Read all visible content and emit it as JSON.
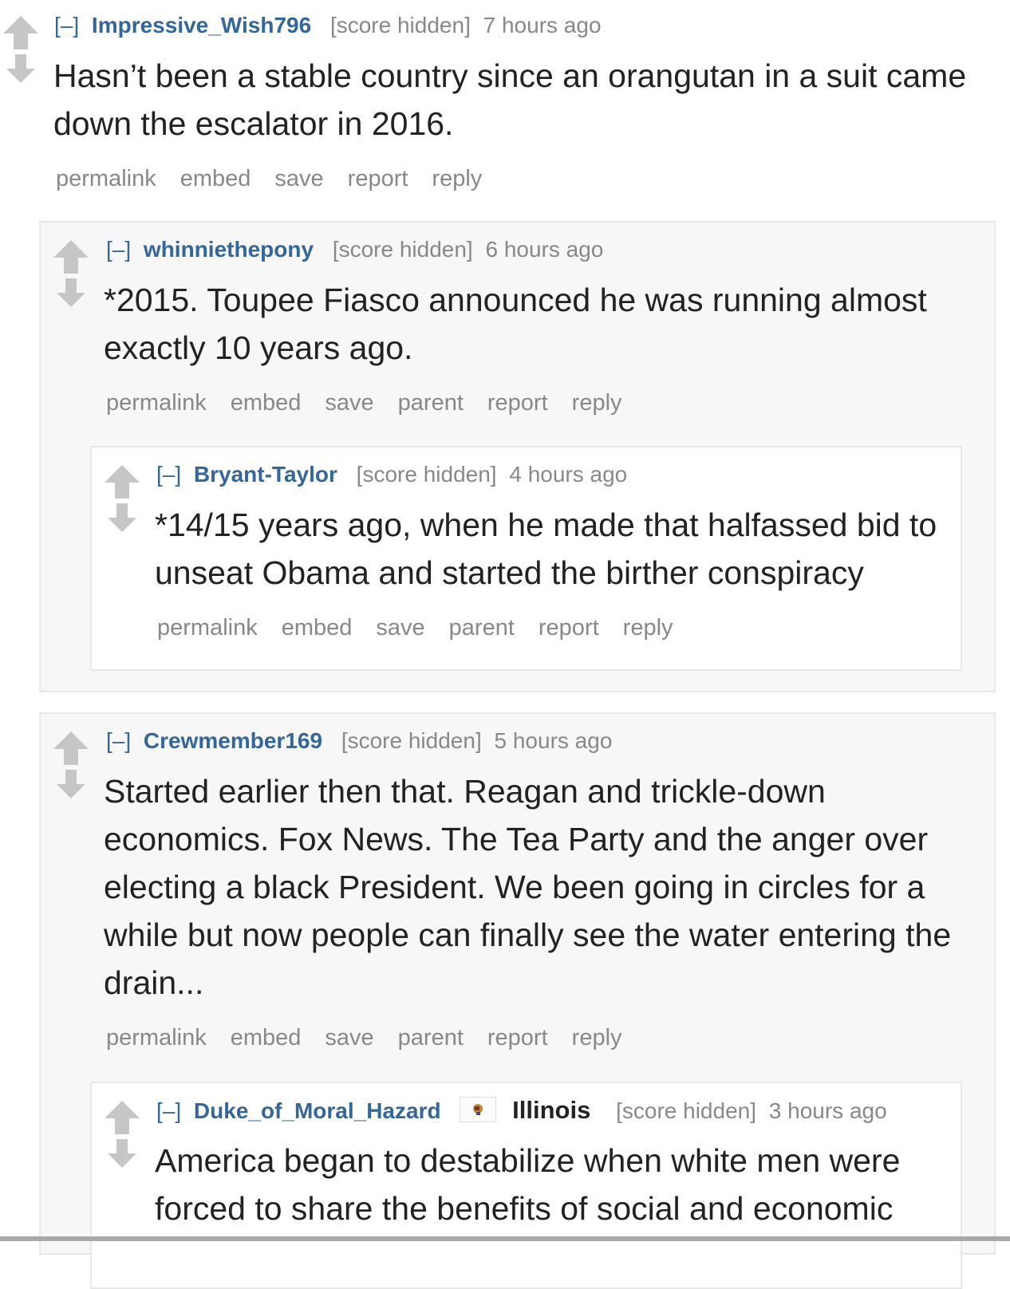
{
  "colors": {
    "author": "#336699",
    "meta": "#888888",
    "body_text": "#222222",
    "nested_bg_gray": "#f7f7f8",
    "border": "#e8e8e8",
    "arrow": "#c6c6c6"
  },
  "icons": {
    "upvote": "upvote-arrow-icon",
    "downvote": "downvote-arrow-icon",
    "flair": "illinois-flag-icon"
  },
  "comments": {
    "c1": {
      "toggle": "[–]",
      "author": "Impressive_Wish796",
      "score": "[score hidden]",
      "time": "7 hours ago",
      "body": "Hasn’t been a stable country since an orangutan in a suit came down the escalator in 2016.",
      "buttons": [
        "permalink",
        "embed",
        "save",
        "report",
        "reply"
      ]
    },
    "c2": {
      "toggle": "[–]",
      "author": "whinniethepony",
      "score": "[score hidden]",
      "time": "6 hours ago",
      "body": "*2015. Toupee Fiasco announced he was running almost exactly 10 years ago.",
      "buttons": [
        "permalink",
        "embed",
        "save",
        "parent",
        "report",
        "reply"
      ]
    },
    "c3": {
      "toggle": "[–]",
      "author": "Bryant-Taylor",
      "score": "[score hidden]",
      "time": "4 hours ago",
      "body": "*14/15 years ago, when he made that halfassed bid to unseat Obama and started the birther conspiracy",
      "buttons": [
        "permalink",
        "embed",
        "save",
        "parent",
        "report",
        "reply"
      ]
    },
    "c4": {
      "toggle": "[–]",
      "author": "Crewmember169",
      "score": "[score hidden]",
      "time": "5 hours ago",
      "body": "Started earlier then that. Reagan and trickle-down economics. Fox News. The Tea Party and the anger over electing a black President. We been going in circles for a while but now people can finally see the water entering the drain...",
      "buttons": [
        "permalink",
        "embed",
        "save",
        "parent",
        "report",
        "reply"
      ]
    },
    "c5": {
      "toggle": "[–]",
      "author": "Duke_of_Moral_Hazard",
      "flair": "Illinois",
      "score": "[score hidden]",
      "time": "3 hours ago",
      "body": "America began to destabilize when white men were forced to share the benefits of social and economic"
    }
  }
}
